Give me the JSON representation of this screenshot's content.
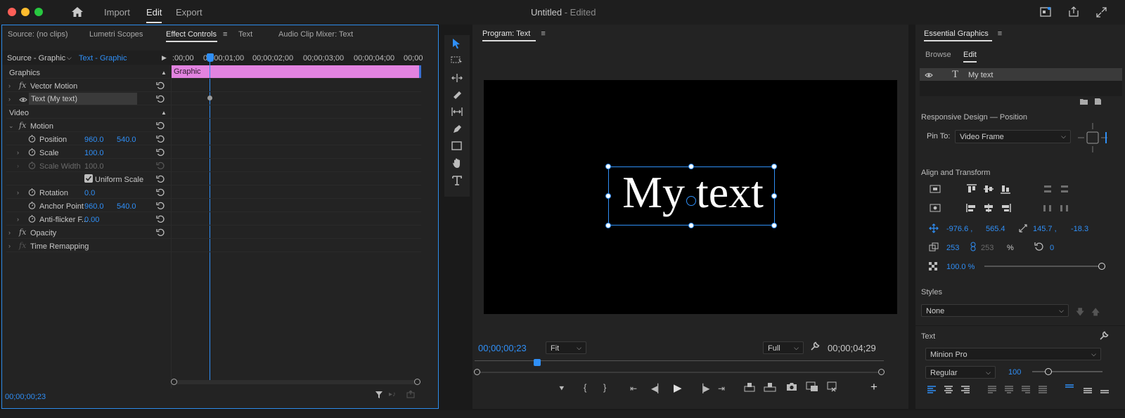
{
  "app": {
    "title": "Untitled",
    "title_suffix": "- Edited",
    "workspaces": [
      "Import",
      "Edit",
      "Export"
    ],
    "active_workspace": "Edit"
  },
  "effect_controls": {
    "tabs": [
      "Source: (no clips)",
      "Lumetri Scopes",
      "Effect Controls",
      "Text",
      "Audio Clip Mixer: Text"
    ],
    "source_label": "Source - Graphic",
    "clip_label": "Text - Graphic",
    "timecodes": [
      ":00;00",
      "00;00;01;00",
      "00;00;02;00",
      "00;00;03;00",
      "00;00;04;00",
      "00;00"
    ],
    "clip_name": "Graphic",
    "footer_timecode": "00;00;00;23",
    "sections": {
      "graphics": "Graphics",
      "video": "Video"
    },
    "rows": {
      "vector_motion": "Vector Motion",
      "text_layer": "Text (My text)",
      "motion": "Motion",
      "position": "Position",
      "position_x": "960.0",
      "position_y": "540.0",
      "scale": "Scale",
      "scale_value": "100.0",
      "scale_width": "Scale Width",
      "scale_width_value": "100.0",
      "uniform_scale": "Uniform Scale",
      "rotation": "Rotation",
      "rotation_value": "0.0",
      "anchor_point": "Anchor Point",
      "anchor_x": "960.0",
      "anchor_y": "540.0",
      "anti_flicker": "Anti-flicker F...",
      "anti_flicker_value": "0.00",
      "opacity": "Opacity",
      "time_remapping": "Time Remapping"
    }
  },
  "program": {
    "title": "Program: Text",
    "canvas_text": "My text",
    "current_time": "00;00;00;23",
    "zoom": "Fit",
    "resolution": "Full",
    "duration": "00;00;04;29"
  },
  "essential_graphics": {
    "title": "Essential Graphics",
    "tabs": [
      "Browse",
      "Edit"
    ],
    "layer_name": "My text",
    "responsive_title": "Responsive Design — Position",
    "pin_to_label": "Pin To:",
    "pin_to_value": "Video Frame",
    "align_title": "Align and Transform",
    "pos_x": "-976.6 ,",
    "pos_y": "565.4",
    "anchor_x": "145.7 ,",
    "anchor_y": "-18.3",
    "scale_w": "253",
    "scale_h": "253",
    "scale_unit": "%",
    "rotation": "0",
    "opacity": "100.0 %",
    "styles_title": "Styles",
    "style_value": "None",
    "text_title": "Text",
    "font": "Minion Pro",
    "font_style": "Regular",
    "font_size": "100"
  },
  "colors": {
    "accent": "#2f8ff7",
    "clip": "#e283e0",
    "panel": "#232323",
    "background": "#1a1a1a"
  }
}
